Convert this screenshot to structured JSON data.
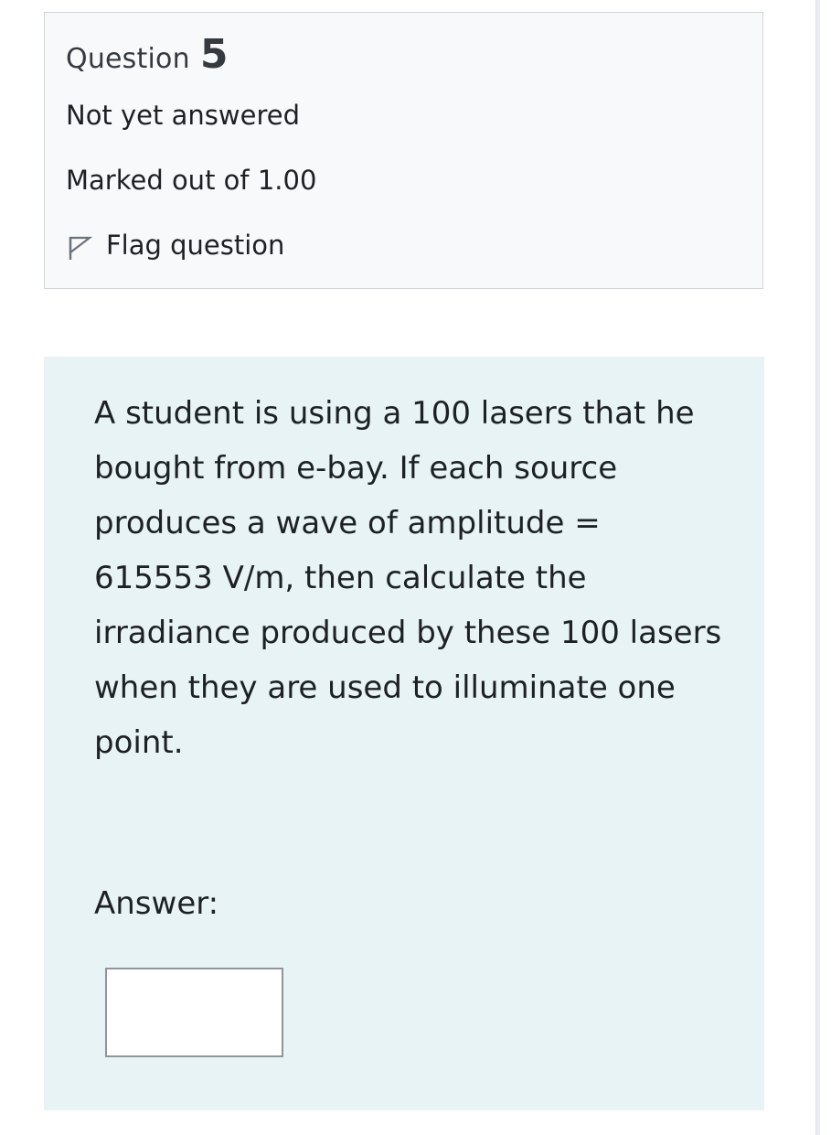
{
  "question_info": {
    "label": "Question",
    "number": "5",
    "state": "Not yet answered",
    "grade": "Marked out of 1.00",
    "flag_label": "Flag question"
  },
  "question": {
    "text": "A student is using a 100 lasers that he bought from e-bay. If each source produces a wave of amplitude = 615553 V/m, then calculate the irradiance produced by these 100 lasers when they are used to illuminate one point.",
    "answer_label": "Answer:",
    "answer_value": ""
  },
  "icons": {
    "flag": "flag-icon"
  }
}
